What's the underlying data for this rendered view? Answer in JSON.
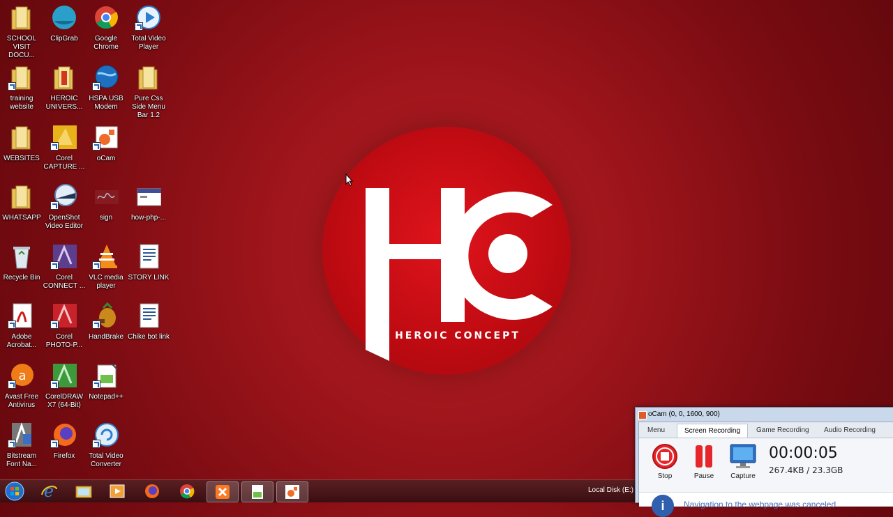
{
  "desktop": {
    "icons": [
      {
        "label": "SCHOOL VISIT DOCU...",
        "icon": "folder-icon"
      },
      {
        "label": "ClipGrab",
        "icon": "clipgrab-icon"
      },
      {
        "label": "Google Chrome",
        "icon": "chrome-icon"
      },
      {
        "label": "Total Video Player",
        "icon": "video-player-icon"
      },
      {
        "label": "training website",
        "icon": "folder-icon"
      },
      {
        "label": "HEROIC UNIVERS...",
        "icon": "folder-icon"
      },
      {
        "label": "HSPA USB Modem",
        "icon": "modem-globe-icon"
      },
      {
        "label": "Pure Css Side Menu Bar 1.2",
        "icon": "folder-icon"
      },
      {
        "label": "WEBSITES",
        "icon": "folder-icon"
      },
      {
        "label": "Corel CAPTURE ...",
        "icon": "corel-capture-icon"
      },
      {
        "label": "oCam",
        "icon": "ocam-icon"
      },
      {
        "label": "WHATSAPP",
        "icon": "folder-icon"
      },
      {
        "label": "OpenShot Video Editor",
        "icon": "openshot-icon"
      },
      {
        "label": "sign",
        "icon": "signature-image-icon"
      },
      {
        "label": "how-php-...",
        "icon": "image-file-icon"
      },
      {
        "label": "Recycle Bin",
        "icon": "recycle-bin-icon"
      },
      {
        "label": "Corel CONNECT ...",
        "icon": "corel-connect-icon"
      },
      {
        "label": "VLC media player",
        "icon": "vlc-icon"
      },
      {
        "label": "STORY LINK",
        "icon": "word-document-icon"
      },
      {
        "label": "Adobe Acrobat...",
        "icon": "acrobat-icon"
      },
      {
        "label": "Corel PHOTO-P...",
        "icon": "corel-photopaint-icon"
      },
      {
        "label": "HandBrake",
        "icon": "handbrake-icon"
      },
      {
        "label": "Chike bot link",
        "icon": "word-document-icon"
      },
      {
        "label": "Avast Free Antivirus",
        "icon": "avast-icon"
      },
      {
        "label": "CorelDRAW X7 (64-Bit)",
        "icon": "coreldraw-icon"
      },
      {
        "label": "Notepad++",
        "icon": "notepadpp-icon"
      },
      {
        "label": "Bitstream Font Na...",
        "icon": "bitstream-icon"
      },
      {
        "label": "Firefox",
        "icon": "firefox-icon"
      },
      {
        "label": "Total Video Converter",
        "icon": "video-converter-icon"
      }
    ]
  },
  "wallpaper": {
    "brand": "HEROIC CONCEPT",
    "monogram": "HC",
    "accent": "#c10b12"
  },
  "taskbar": {
    "items": [
      "start-orb-icon",
      "internet-explorer-icon",
      "file-explorer-icon",
      "media-player-icon",
      "firefox-icon",
      "chrome-icon",
      "xampp-icon",
      "notepadpp-icon",
      "ocam-icon"
    ],
    "tray_text": "Local Disk (E:)"
  },
  "ocam": {
    "title": "oCam (0, 0, 1600, 900)",
    "tabs": [
      "Menu",
      "Screen Recording",
      "Game Recording",
      "Audio Recording"
    ],
    "active_tab": "Screen Recording",
    "buttons": {
      "stop": "Stop",
      "pause": "Pause",
      "capture": "Capture"
    },
    "timer": "00:00:05",
    "size": "267.4KB / 23.3GB",
    "notice": "Navigation to the webpage was canceled"
  }
}
